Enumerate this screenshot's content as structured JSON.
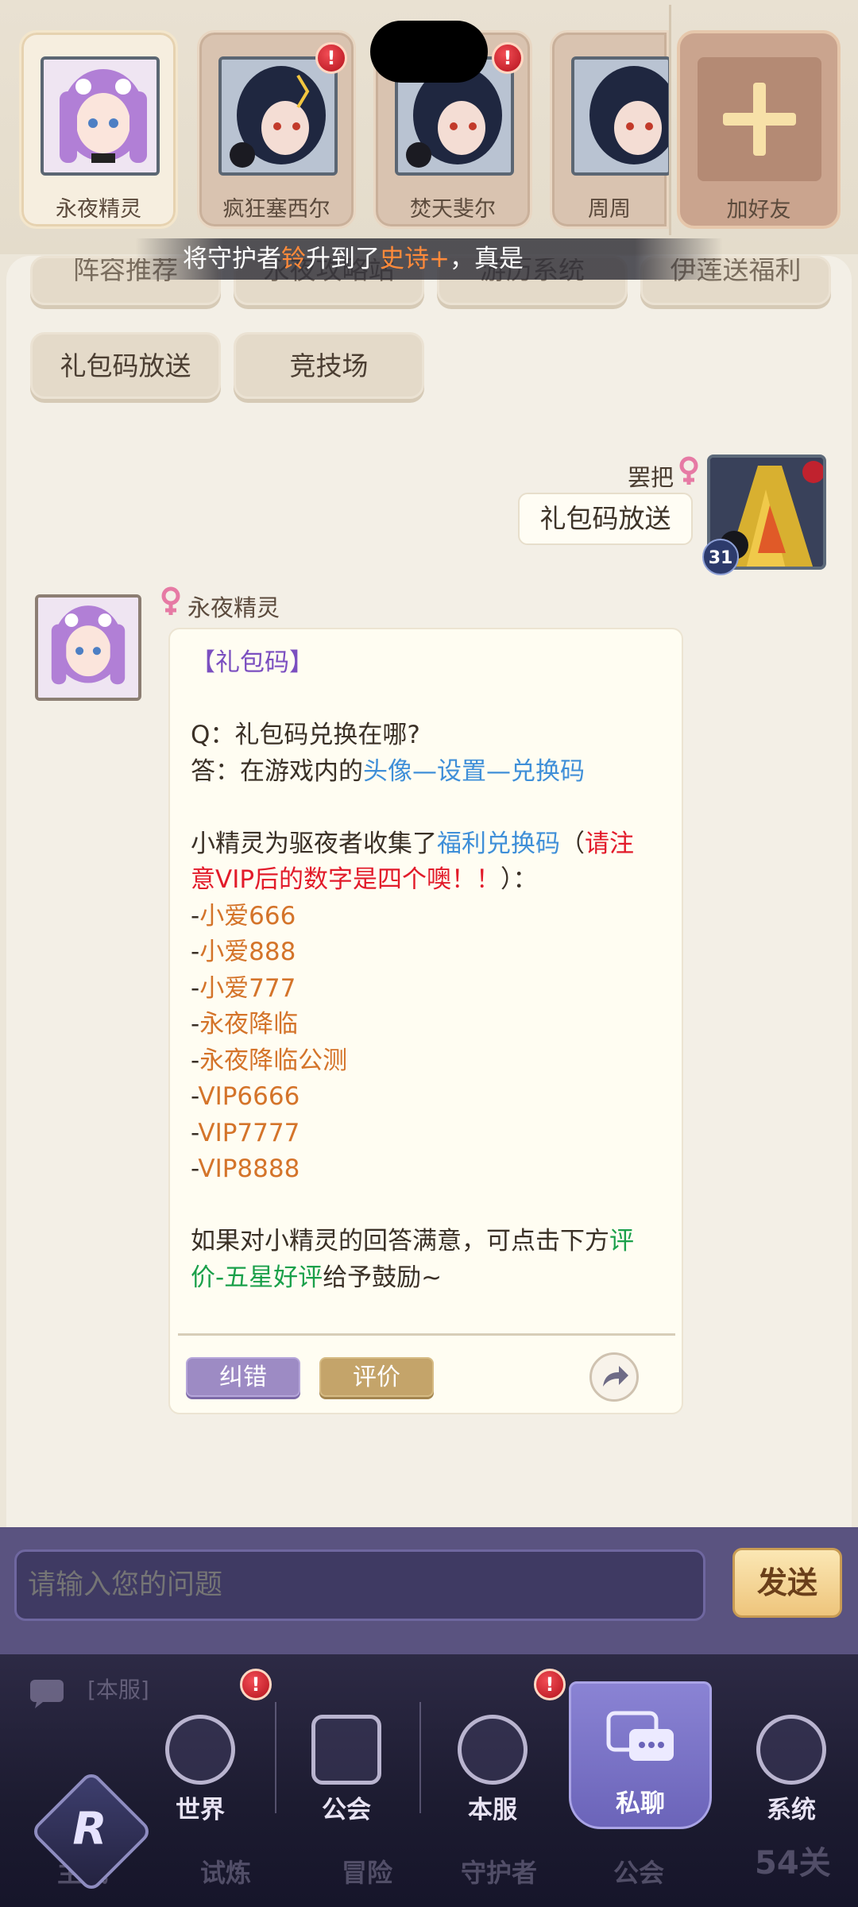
{
  "friends": [
    {
      "name": "永夜精灵",
      "active": true,
      "alert": false
    },
    {
      "name": "疯狂塞西尔",
      "active": false,
      "alert": true
    },
    {
      "name": "焚天斐尔",
      "active": false,
      "alert": true
    },
    {
      "name": "周周",
      "active": false,
      "alert": false
    }
  ],
  "add_friend_label": "加好友",
  "ticker": {
    "part1": "将守护者",
    "part2": "铃",
    "part3": "升到了",
    "part4": "史诗+",
    "part5": "，真是"
  },
  "quick_buttons": [
    "阵容推荐",
    "永夜攻略站",
    "游历系统",
    "伊莲送福利",
    "礼包码放送",
    "竞技场"
  ],
  "user_message": {
    "name": "罢把",
    "text": "礼包码放送",
    "level": "31"
  },
  "bot_message": {
    "name": "永夜精灵",
    "title": "【礼包码】",
    "q": "Q：礼包码兑换在哪?",
    "a_prefix": "答：在游戏内的",
    "a_path": "头像—设置—兑换码",
    "collect_prefix": "小精灵为驱夜者收集了",
    "collect_link": "福利兑换码",
    "collect_paren_open": "（",
    "collect_warning_1": "请注",
    "collect_warning_2": "意VIP后的数字是四个噢！！",
    "collect_paren_close": "）：",
    "codes": [
      "小爱666",
      "小爱888",
      "小爱777",
      "永夜降临",
      "永夜降临公测",
      "VIP6666",
      "VIP7777",
      "VIP8888"
    ],
    "outro_1": "如果对小精灵的回答满意，可点击下方",
    "outro_link_1": "评",
    "outro_link_2": "价-五星好评",
    "outro_2": "给予鼓励~",
    "btn_correct": "纠错",
    "btn_rate": "评价"
  },
  "input": {
    "placeholder": "请输入您的问题",
    "send_label": "发送"
  },
  "bottom_faint": {
    "chat_preview": "[本服]",
    "tabs": [
      "主城",
      "试炼",
      "冒险",
      "守护者",
      "公会"
    ],
    "stage": "54关"
  },
  "nav_tabs": [
    {
      "label": "世界",
      "alert": true
    },
    {
      "label": "公会",
      "alert": false
    },
    {
      "label": "本服",
      "alert": true
    },
    {
      "label": "私聊",
      "alert": false,
      "active": true
    },
    {
      "label": "系统",
      "alert": false
    }
  ]
}
